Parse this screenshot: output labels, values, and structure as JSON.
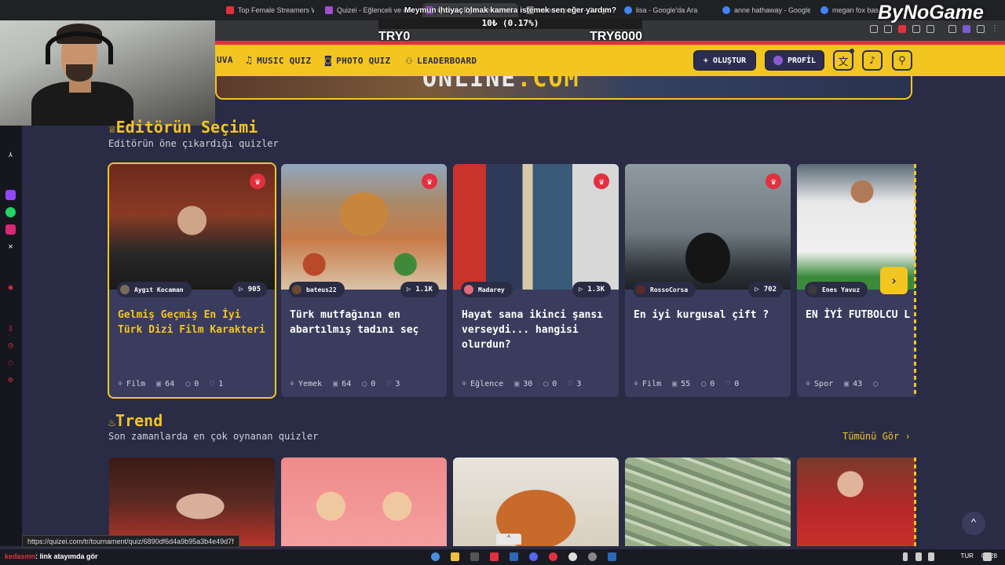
{
  "browser": {
    "tabs": [
      {
        "title": "Top Female Streamers W",
        "color": "#e3303f"
      },
      {
        "title": "Quizei - Eğlenceli ve etki",
        "color": "#a04fd0"
      },
      {
        "title": "Quizei - Eğlenceli ve etk",
        "color": "#a04fd0",
        "active": true
      },
      {
        "title": "ester exposito - Google",
        "color": "#888888"
      },
      {
        "title": "lisa - Google'da Ara",
        "color": "#4285f4"
      },
      {
        "title": "anne hathaway - Google",
        "color": "#4285f4"
      },
      {
        "title": "megan fox bas",
        "color": "#4285f4"
      }
    ],
    "status_url": "https://quizei.com/tr/tournament/quiz/6890df6d4a9b95a3b4e49d7f"
  },
  "stream": {
    "donation_message": "Meymun ihtiyaç olmak kamera istemek sen eğer yardım?",
    "progress_text": "10₺ (0.17%)",
    "progress": 0.17,
    "min_label": "TRY0",
    "max_label": "TRY6000",
    "logo": "ByNoGame",
    "chat_user": "kedasmn",
    "chat_text": ": link atayımda gör"
  },
  "site": {
    "nav": [
      {
        "label": "UVA",
        "icon": "house-icon"
      },
      {
        "label": "MUSIC QUIZ",
        "icon": "music-icon"
      },
      {
        "label": "PHOTO QUIZ",
        "icon": "camera-icon"
      },
      {
        "label": "LEADERBOARD",
        "icon": "medal-icon"
      }
    ],
    "create_label": "+ OLUŞTUR",
    "profile_label": "PROFİL",
    "banner_text_white": "ONLINE",
    "banner_text_yellow": ".COM"
  },
  "editors": {
    "title": "Editörün Seçimi",
    "subtitle": "Editörün öne çıkardığı quizler",
    "cards": [
      {
        "author": "Aygıt Kocaman",
        "plays": "905",
        "title": "Gelmiş Geçmiş En İyi Türk Dizi Film Karakteri",
        "category": "Film",
        "questions": "64",
        "comments": "0",
        "likes": "1",
        "selected": true
      },
      {
        "author": "bateus22",
        "plays": "1.1K",
        "title": "Türk mutfağının en abartılmış tadını seç",
        "category": "Yemek",
        "questions": "64",
        "comments": "0",
        "likes": "3"
      },
      {
        "author": "Madarey",
        "plays": "1.3K",
        "title": "Hayat sana ikinci şansı verseydi... hangisi olurdun?",
        "category": "Eğlence",
        "questions": "30",
        "comments": "0",
        "likes": "3"
      },
      {
        "author": "RossoCorsa",
        "plays": "702",
        "title": "En iyi kurgusal çift ?",
        "category": "Film",
        "questions": "55",
        "comments": "0",
        "likes": "0"
      },
      {
        "author": "Enes Yavuz",
        "plays": "",
        "title": "EN İYİ FUTBOLCU L",
        "category": "Spor",
        "questions": "43",
        "comments": "",
        "likes": ""
      }
    ]
  },
  "trend": {
    "title": "Trend",
    "subtitle": "Son zamanlarda en çok oynanan quizler",
    "see_all": "Tümünü Gör ›"
  },
  "tray": {
    "lang": "TUR",
    "time": "01:28"
  }
}
